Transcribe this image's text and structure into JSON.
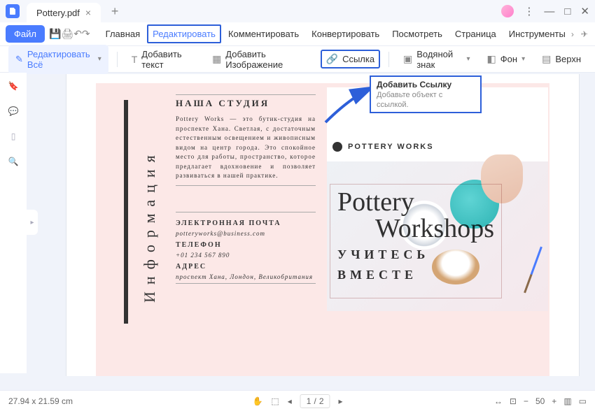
{
  "titlebar": {
    "filename": "Pottery.pdf"
  },
  "menubar": {
    "file": "Файл",
    "tabs": [
      "Главная",
      "Редактировать",
      "Комментировать",
      "Конвертировать",
      "Посмотреть",
      "Страница",
      "Инструменты"
    ],
    "active_index": 1
  },
  "toolbar": {
    "edit_all": "Редактировать Всё",
    "add_text": "Добавить текст",
    "add_image": "Добавить Изображение",
    "link": "Ссылка",
    "watermark": "Водяной знак",
    "background": "Фон",
    "header": "Верхн"
  },
  "tooltip": {
    "title": "Добавить Ссылку",
    "desc": "Добавьте объект с ссылкой."
  },
  "doc": {
    "vertical_label": "Информация",
    "studio_title": "НАША СТУДИЯ",
    "studio_body": "Pottery Works — это бутик-студия на проспекте Хана. Светлая, с достаточным естественным освещением и живописным видом на центр города. Это спокойное место для работы, пространство, которое предлагает вдохновение и позволяет развиваться в нашей практике.",
    "email_h": "ЭЛЕКТРОННАЯ ПОЧТА",
    "email": "potteryworks@business.com",
    "phone_h": "ТЕЛЕФОН",
    "phone": "+01 234 567 890",
    "addr_h": "АДРЕС",
    "addr": "проспект Хана, Лондон, Великобритания",
    "logo": "POTTERY WORKS",
    "overlay_h1a": "Pottery",
    "overlay_h1b": "Workshops",
    "overlay_h2a": "УЧИТЕСЬ",
    "overlay_h2b": "ВМЕСТЕ"
  },
  "status": {
    "dims": "27.94 x 21.59 cm",
    "page_cur": "1",
    "page_total": "2",
    "zoom": "50"
  }
}
